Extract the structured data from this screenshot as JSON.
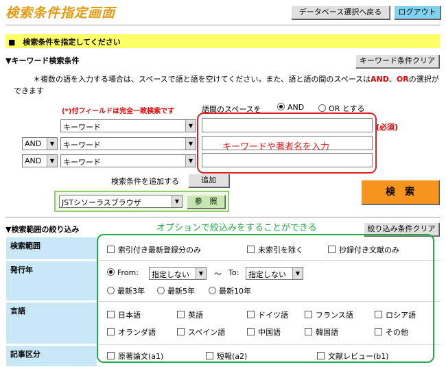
{
  "header": {
    "title": "検索条件指定画面",
    "back_button": "データベース選択へ戻る",
    "logout_button": "ログアウト"
  },
  "banner": "■　検索条件を指定してください",
  "keyword_section": {
    "title": "▼キーワード検索条件",
    "clear_button": "キーワード条件クリア",
    "note_1": "＊複数の語を入力する場合は、スペースで語と語を空けてください。また、語と語の間のスペースは",
    "note_and": "AND",
    "note_sep": "、",
    "note_or": "OR",
    "note_2": "の選択が",
    "note_3": "できます",
    "exact_match_note": "(*)付フィールドは完全一致検索です",
    "space_label": "語間のスペースを",
    "space_and": "AND",
    "space_or": "OR とする",
    "space_selected": "AND",
    "rows": [
      {
        "operator": "",
        "field": "キーワード",
        "value": ""
      },
      {
        "operator": "AND",
        "field": "キーワード",
        "value": ""
      },
      {
        "operator": "AND",
        "field": "キーワード",
        "value": ""
      }
    ],
    "required_label": "(必須)",
    "callout": "キーワードや著者名を入力",
    "add_condition_label": "検索条件を追加する",
    "add_button": "追加",
    "thesaurus_select": "JSTシソーラスブラウザ",
    "reference_button": "参　照",
    "search_button": "検　索"
  },
  "filter_section": {
    "title": "▼検索範囲の絞り込み",
    "callout": "オプションで絞込みをすることができる",
    "clear_button": "絞り込み条件クリア",
    "scope": {
      "label": "検索範囲",
      "options": [
        "索引付き最新登録分のみ",
        "未索引を除く",
        "抄録付き文献のみ"
      ]
    },
    "year": {
      "label": "発行年",
      "from_label": "From:",
      "from_value": "指定しない",
      "tilde": "～",
      "to_label": "To:",
      "to_value": "指定しない",
      "recent": [
        "最新3年",
        "最新5年",
        "最新10年"
      ]
    },
    "language": {
      "label": "言語",
      "row1": [
        "日本語",
        "英語",
        "ドイツ語",
        "フランス語",
        "ロシア語"
      ],
      "row2": [
        "オランダ語",
        "スペイン語",
        "中国語",
        "韓国語",
        "その他"
      ]
    },
    "article_type": {
      "label": "記事区分",
      "options": [
        "原著論文(a1)",
        "短報(a2)",
        "文献レビュー(b1)"
      ]
    }
  }
}
